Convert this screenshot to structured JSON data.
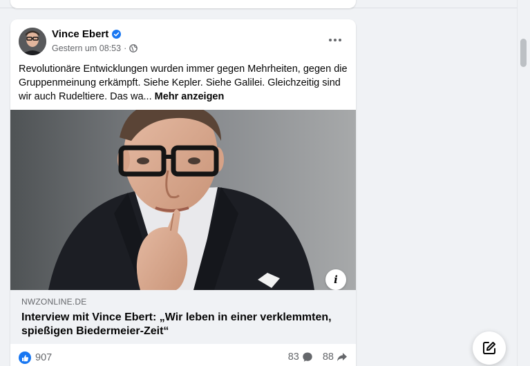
{
  "post": {
    "author": "Vince Ebert",
    "timestamp": "Gestern um 08:53",
    "meta_separator": "·",
    "audience_icon": "globe-icon",
    "verified_icon": "verified-badge-icon",
    "body_text": "Revolutionäre Entwicklungen wurden immer gegen Mehrheiten, gegen die Gruppenmeinung erkämpft. Siehe Kepler. Siehe Galilei. Gleichzeitig sind wir auch Rudeltiere. Das wa...",
    "see_more": "Mehr anzeigen",
    "link": {
      "domain": "NWZONLINE.DE",
      "title": "Interview mit Vince Ebert: „Wir leben in einer verklemmten, spießigen Biedermeier-Zeit“",
      "info_icon": "i"
    },
    "stats": {
      "likes": "907",
      "comments": "83",
      "shares": "88"
    }
  },
  "colors": {
    "accent": "#1877f2",
    "secondary_text": "#65676b",
    "background": "#f0f2f5"
  }
}
